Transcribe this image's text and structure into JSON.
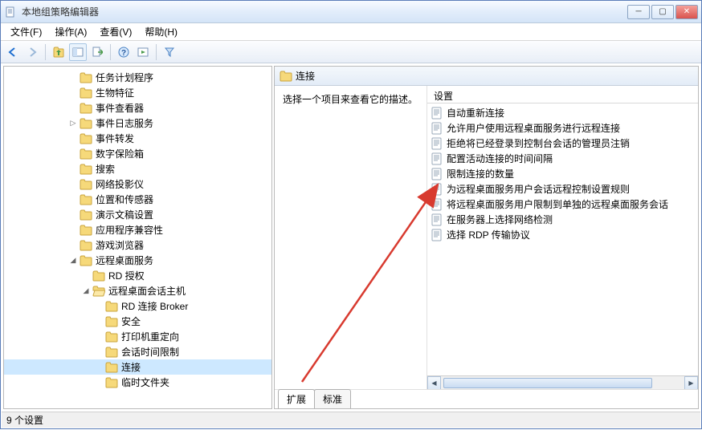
{
  "window": {
    "title": "本地组策略编辑器"
  },
  "menubar": [
    "文件(F)",
    "操作(A)",
    "查看(V)",
    "帮助(H)"
  ],
  "tree": [
    {
      "level": 5,
      "toggle": "",
      "label": "任务计划程序"
    },
    {
      "level": 5,
      "toggle": "",
      "label": "生物特征"
    },
    {
      "level": 5,
      "toggle": "",
      "label": "事件查看器"
    },
    {
      "level": 5,
      "toggle": "▷",
      "label": "事件日志服务"
    },
    {
      "level": 5,
      "toggle": "",
      "label": "事件转发"
    },
    {
      "level": 5,
      "toggle": "",
      "label": "数字保险箱"
    },
    {
      "level": 5,
      "toggle": "",
      "label": "搜索"
    },
    {
      "level": 5,
      "toggle": "",
      "label": "网络投影仪"
    },
    {
      "level": 5,
      "toggle": "",
      "label": "位置和传感器"
    },
    {
      "level": 5,
      "toggle": "",
      "label": "演示文稿设置"
    },
    {
      "level": 5,
      "toggle": "",
      "label": "应用程序兼容性"
    },
    {
      "level": 5,
      "toggle": "",
      "label": "游戏浏览器"
    },
    {
      "level": 5,
      "toggle": "◢",
      "label": "远程桌面服务"
    },
    {
      "level": 6,
      "toggle": "",
      "label": "RD 授权"
    },
    {
      "level": 6,
      "toggle": "◢",
      "label": "远程桌面会话主机",
      "open": true
    },
    {
      "level": 7,
      "toggle": "",
      "label": "RD 连接 Broker"
    },
    {
      "level": 7,
      "toggle": "",
      "label": "安全"
    },
    {
      "level": 7,
      "toggle": "",
      "label": "打印机重定向"
    },
    {
      "level": 7,
      "toggle": "",
      "label": "会话时间限制"
    },
    {
      "level": 7,
      "toggle": "",
      "label": "连接",
      "selected": true
    },
    {
      "level": 7,
      "toggle": "",
      "label": "临时文件夹"
    }
  ],
  "detail": {
    "header": "连接",
    "description": "选择一个项目来查看它的描述。",
    "list_header": "设置",
    "policies": [
      "自动重新连接",
      "允许用户使用远程桌面服务进行远程连接",
      "拒绝将已经登录到控制台会话的管理员注销",
      "配置活动连接的时间间隔",
      "限制连接的数量",
      "为远程桌面服务用户会话远程控制设置规则",
      "将远程桌面服务用户限制到单独的远程桌面服务会话",
      "在服务器上选择网络检测",
      "选择 RDP 传输协议"
    ],
    "tabs": [
      "扩展",
      "标准"
    ],
    "active_tab": 0
  },
  "statusbar": "9 个设置"
}
